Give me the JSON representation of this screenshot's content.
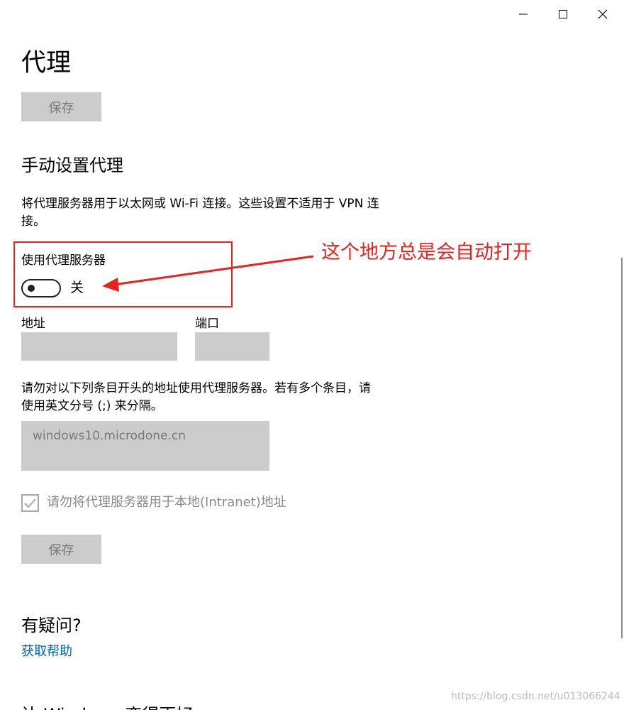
{
  "window": {
    "minimize_icon": "minimize-icon",
    "maximize_icon": "maximize-icon",
    "close_icon": "close-icon"
  },
  "page": {
    "title": "代理",
    "save_label_top": "保存"
  },
  "manual_proxy": {
    "title": "手动设置代理",
    "description_line1": "将代理服务器用于以太网或 Wi-Fi 连接。这些设置不适用于 VPN 连",
    "description_line2": "接。",
    "use_proxy_label": "使用代理服务器",
    "toggle_state": "关",
    "toggle_on": false,
    "address_label": "地址",
    "address_value": "",
    "port_label": "端口",
    "port_value": "",
    "exceptions_desc_line1": "请勿对以下列条目开头的地址使用代理服务器。若有多个条目，请",
    "exceptions_desc_line2": "使用英文分号 (;) 来分隔。",
    "exceptions_value": "windows10.microdone.cn",
    "bypass_local_label": "请勿将代理服务器用于本地(Intranet)地址",
    "bypass_local_checked": true,
    "save_label": "保存"
  },
  "annotation": {
    "text": "这个地方总是会自动打开",
    "color": "#e8231f"
  },
  "help": {
    "title": "有疑问?",
    "link": "获取帮助"
  },
  "next_section_cutoff": "让 Windows 变得更好",
  "watermark": "https://blog.csdn.net/u013066244",
  "colors": {
    "accent_link": "#0063b1",
    "disabled_bg": "#cccccc",
    "annotation_red": "#e8231f"
  }
}
